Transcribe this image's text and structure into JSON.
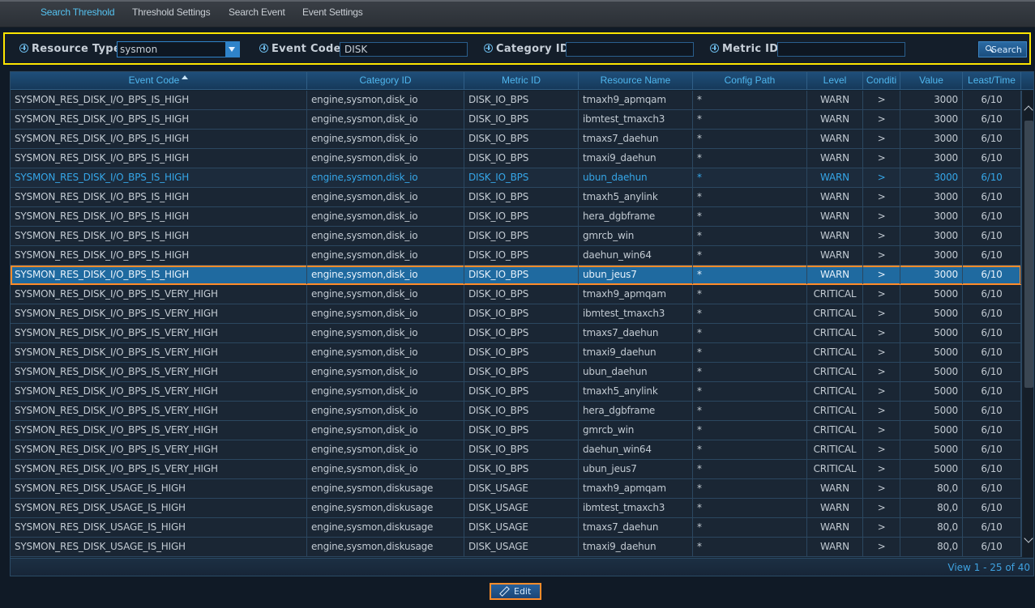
{
  "tabs": [
    {
      "label": "Search Threshold",
      "active": true
    },
    {
      "label": "Threshold Settings",
      "active": false
    },
    {
      "label": "Search Event",
      "active": false
    },
    {
      "label": "Event Settings",
      "active": false
    }
  ],
  "filter": {
    "resource_type_label": "Resource Type",
    "resource_type_value": "sysmon",
    "event_code_label": "Event Code",
    "event_code_value": "DISK",
    "category_id_label": "Category ID",
    "category_id_value": "",
    "metric_id_label": "Metric ID",
    "metric_id_value": "",
    "search_label": "Search"
  },
  "table": {
    "columns": [
      "Event Code",
      "Category ID",
      "Metric ID",
      "Resource Name",
      "Config Path",
      "Level",
      "Conditi",
      "Value",
      "Least/Time"
    ],
    "sorted_column": "Event Code",
    "rows": [
      [
        "SYSMON_RES_DISK_I/O_BPS_IS_HIGH",
        "engine,sysmon,disk_io",
        "DISK_IO_BPS",
        "tmaxh9_apmqam",
        "*",
        "WARN",
        ">",
        "3000",
        "6/10"
      ],
      [
        "SYSMON_RES_DISK_I/O_BPS_IS_HIGH",
        "engine,sysmon,disk_io",
        "DISK_IO_BPS",
        "ibmtest_tmaxch3",
        "*",
        "WARN",
        ">",
        "3000",
        "6/10"
      ],
      [
        "SYSMON_RES_DISK_I/O_BPS_IS_HIGH",
        "engine,sysmon,disk_io",
        "DISK_IO_BPS",
        "tmaxs7_daehun",
        "*",
        "WARN",
        ">",
        "3000",
        "6/10"
      ],
      [
        "SYSMON_RES_DISK_I/O_BPS_IS_HIGH",
        "engine,sysmon,disk_io",
        "DISK_IO_BPS",
        "tmaxi9_daehun",
        "*",
        "WARN",
        ">",
        "3000",
        "6/10"
      ],
      [
        "SYSMON_RES_DISK_I/O_BPS_IS_HIGH",
        "engine,sysmon,disk_io",
        "DISK_IO_BPS",
        "ubun_daehun",
        "*",
        "WARN",
        ">",
        "3000",
        "6/10"
      ],
      [
        "SYSMON_RES_DISK_I/O_BPS_IS_HIGH",
        "engine,sysmon,disk_io",
        "DISK_IO_BPS",
        "tmaxh5_anylink",
        "*",
        "WARN",
        ">",
        "3000",
        "6/10"
      ],
      [
        "SYSMON_RES_DISK_I/O_BPS_IS_HIGH",
        "engine,sysmon,disk_io",
        "DISK_IO_BPS",
        "hera_dgbframe",
        "*",
        "WARN",
        ">",
        "3000",
        "6/10"
      ],
      [
        "SYSMON_RES_DISK_I/O_BPS_IS_HIGH",
        "engine,sysmon,disk_io",
        "DISK_IO_BPS",
        "gmrcb_win",
        "*",
        "WARN",
        ">",
        "3000",
        "6/10"
      ],
      [
        "SYSMON_RES_DISK_I/O_BPS_IS_HIGH",
        "engine,sysmon,disk_io",
        "DISK_IO_BPS",
        "daehun_win64",
        "*",
        "WARN",
        ">",
        "3000",
        "6/10"
      ],
      [
        "SYSMON_RES_DISK_I/O_BPS_IS_HIGH",
        "engine,sysmon,disk_io",
        "DISK_IO_BPS",
        "ubun_jeus7",
        "*",
        "WARN",
        ">",
        "3000",
        "6/10"
      ],
      [
        "SYSMON_RES_DISK_I/O_BPS_IS_VERY_HIGH",
        "engine,sysmon,disk_io",
        "DISK_IO_BPS",
        "tmaxh9_apmqam",
        "*",
        "CRITICAL",
        ">",
        "5000",
        "6/10"
      ],
      [
        "SYSMON_RES_DISK_I/O_BPS_IS_VERY_HIGH",
        "engine,sysmon,disk_io",
        "DISK_IO_BPS",
        "ibmtest_tmaxch3",
        "*",
        "CRITICAL",
        ">",
        "5000",
        "6/10"
      ],
      [
        "SYSMON_RES_DISK_I/O_BPS_IS_VERY_HIGH",
        "engine,sysmon,disk_io",
        "DISK_IO_BPS",
        "tmaxs7_daehun",
        "*",
        "CRITICAL",
        ">",
        "5000",
        "6/10"
      ],
      [
        "SYSMON_RES_DISK_I/O_BPS_IS_VERY_HIGH",
        "engine,sysmon,disk_io",
        "DISK_IO_BPS",
        "tmaxi9_daehun",
        "*",
        "CRITICAL",
        ">",
        "5000",
        "6/10"
      ],
      [
        "SYSMON_RES_DISK_I/O_BPS_IS_VERY_HIGH",
        "engine,sysmon,disk_io",
        "DISK_IO_BPS",
        "ubun_daehun",
        "*",
        "CRITICAL",
        ">",
        "5000",
        "6/10"
      ],
      [
        "SYSMON_RES_DISK_I/O_BPS_IS_VERY_HIGH",
        "engine,sysmon,disk_io",
        "DISK_IO_BPS",
        "tmaxh5_anylink",
        "*",
        "CRITICAL",
        ">",
        "5000",
        "6/10"
      ],
      [
        "SYSMON_RES_DISK_I/O_BPS_IS_VERY_HIGH",
        "engine,sysmon,disk_io",
        "DISK_IO_BPS",
        "hera_dgbframe",
        "*",
        "CRITICAL",
        ">",
        "5000",
        "6/10"
      ],
      [
        "SYSMON_RES_DISK_I/O_BPS_IS_VERY_HIGH",
        "engine,sysmon,disk_io",
        "DISK_IO_BPS",
        "gmrcb_win",
        "*",
        "CRITICAL",
        ">",
        "5000",
        "6/10"
      ],
      [
        "SYSMON_RES_DISK_I/O_BPS_IS_VERY_HIGH",
        "engine,sysmon,disk_io",
        "DISK_IO_BPS",
        "daehun_win64",
        "*",
        "CRITICAL",
        ">",
        "5000",
        "6/10"
      ],
      [
        "SYSMON_RES_DISK_I/O_BPS_IS_VERY_HIGH",
        "engine,sysmon,disk_io",
        "DISK_IO_BPS",
        "ubun_jeus7",
        "*",
        "CRITICAL",
        ">",
        "5000",
        "6/10"
      ],
      [
        "SYSMON_RES_DISK_USAGE_IS_HIGH",
        "engine,sysmon,diskusage",
        "DISK_USAGE",
        "tmaxh9_apmqam",
        "*",
        "WARN",
        ">",
        "80,0",
        "6/10"
      ],
      [
        "SYSMON_RES_DISK_USAGE_IS_HIGH",
        "engine,sysmon,diskusage",
        "DISK_USAGE",
        "ibmtest_tmaxch3",
        "*",
        "WARN",
        ">",
        "80,0",
        "6/10"
      ],
      [
        "SYSMON_RES_DISK_USAGE_IS_HIGH",
        "engine,sysmon,diskusage",
        "DISK_USAGE",
        "tmaxs7_daehun",
        "*",
        "WARN",
        ">",
        "80,0",
        "6/10"
      ],
      [
        "SYSMON_RES_DISK_USAGE_IS_HIGH",
        "engine,sysmon,diskusage",
        "DISK_USAGE",
        "tmaxi9_daehun",
        "*",
        "WARN",
        ">",
        "80,0",
        "6/10"
      ]
    ],
    "hover_row_index": 4,
    "selected_row_index": 9,
    "pager_info": "View 1 - 25 of 40"
  },
  "edit_label": "Edit",
  "colors": {
    "accent": "#4fb6ee",
    "selected_row": "#1f6aa0",
    "highlight_outline": "#ff8c2a",
    "filter_outline": "#ffe600"
  },
  "icons": [
    "plus-circle-icon",
    "dropdown-arrow-icon",
    "search-icon",
    "sort-asc-icon",
    "scroll-up-icon",
    "scroll-down-icon",
    "pencil-icon"
  ]
}
